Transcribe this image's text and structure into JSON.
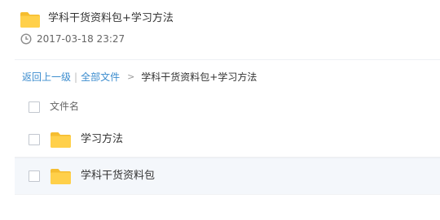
{
  "header": {
    "title": "学科干货资料包+学习方法",
    "date": "2017-03-18 23:27",
    "folder_icon": "folder-icon",
    "clock_icon": "clock-icon"
  },
  "breadcrumb": {
    "back": "返回上一级",
    "separator": "|",
    "all_files": "全部文件",
    "arrow": ">",
    "current": "学科干货资料包+学习方法"
  },
  "list": {
    "column_name": "文件名",
    "items": [
      {
        "name": "学习方法",
        "icon": "folder-icon"
      },
      {
        "name": "学科干货资料包",
        "icon": "folder-icon"
      }
    ]
  },
  "colors": {
    "folder": "#ffd04a",
    "link": "#3b8cce",
    "row_hover": "#f4f7fb"
  }
}
